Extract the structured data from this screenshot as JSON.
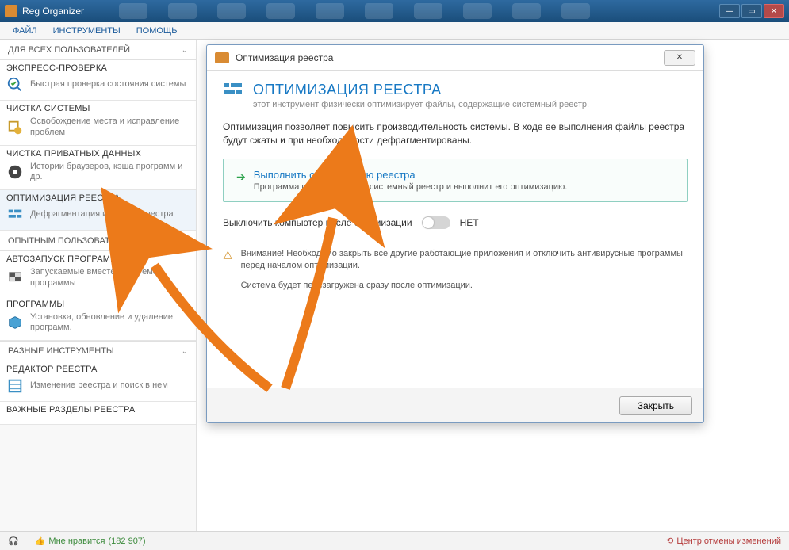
{
  "titlebar": {
    "app": "Reg Organizer"
  },
  "menu": {
    "file": "ФАЙЛ",
    "tools": "ИНСТРУМЕНТЫ",
    "help": "ПОМОЩЬ"
  },
  "sidebar": {
    "grp_all_users": "ДЛЯ ВСЕХ ПОЛЬЗОВАТЕЛЕЙ",
    "grp_expert": "ОПЫТНЫМ ПОЛЬЗОВАТЕЛЯМ",
    "grp_misc": "РАЗНЫЕ ИНСТРУМЕНТЫ",
    "items": {
      "express": {
        "title": "ЭКСПРЕСС-ПРОВЕРКА",
        "sub": "Быстрая проверка состояния системы"
      },
      "clean": {
        "title": "ЧИСТКА СИСТЕМЫ",
        "sub": "Освобождение места и исправление проблем"
      },
      "private": {
        "title": "ЧИСТКА ПРИВАТНЫХ ДАННЫХ",
        "sub": "Истории браузеров, кэша программ и др."
      },
      "optimize": {
        "title": "ОПТИМИЗАЦИЯ РЕЕСТРА",
        "sub": "Дефрагментация и сжатие реестра"
      },
      "autorun": {
        "title": "АВТОЗАПУСК ПРОГРАММ",
        "sub": "Запускаемые вместе с системой программы"
      },
      "programs": {
        "title": "ПРОГРАММЫ",
        "sub": "Установка, обновление и удаление программ."
      },
      "regedit": {
        "title": "РЕДАКТОР РЕЕСТРА",
        "sub": "Изменение реестра и поиск в нем"
      },
      "important": {
        "title": "ВАЖНЫЕ РАЗДЕЛЫ РЕЕСТРА",
        "sub": ""
      }
    }
  },
  "dialog": {
    "title": "Оптимизация реестра",
    "heading": "ОПТИМИЗАЦИЯ РЕЕСТРА",
    "heading_sub": "этот инструмент физически оптимизирует файлы, содержащие системный реестр.",
    "desc": "Оптимизация позволяет повысить производительность системы. В ходе ее выполнения файлы реестра будут сжаты и при необходимости дефрагментированы.",
    "action_title": "Выполнить оптимизацию реестра",
    "action_sub": "Программа проанализирует системный реестр и выполнит его оптимизацию.",
    "toggle_label": "Выключить компьютер после оптимизации",
    "toggle_state": "НЕТ",
    "warning": "Внимание! Необходимо закрыть все другие работающие приложения и отключить антивирусные программы перед началом оптимизации.",
    "restart_note": "Система будет перезагружена сразу после оптимизации.",
    "close_btn": "Закрыть"
  },
  "statusbar": {
    "like_prefix": "Мне нравится",
    "like_count": "(182 907)",
    "undo_center": "Центр отмены изменений"
  }
}
